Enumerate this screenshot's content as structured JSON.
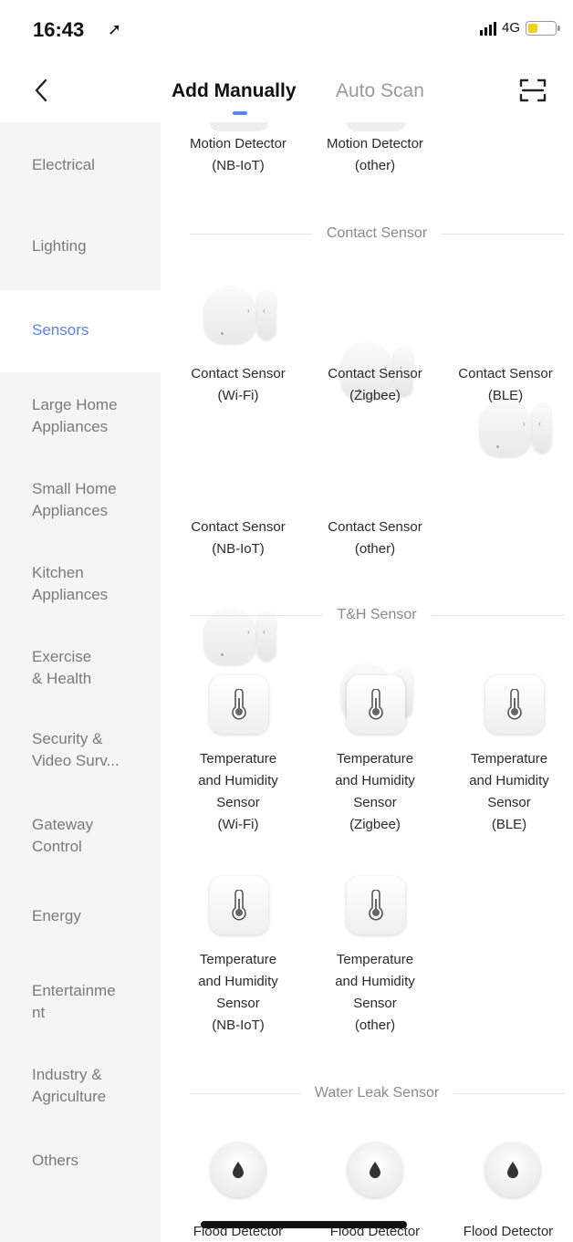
{
  "status_bar": {
    "time": "16:43",
    "network": "4G"
  },
  "nav": {
    "tabs": [
      {
        "label": "Add Manually"
      },
      {
        "label": "Auto Scan"
      }
    ]
  },
  "sidebar": {
    "items": [
      {
        "label": "Electrical"
      },
      {
        "label": "Lighting"
      },
      {
        "label": "Sensors"
      },
      {
        "label": "Large Home\nAppliances"
      },
      {
        "label": "Small Home\nAppliances"
      },
      {
        "label": "Kitchen\nAppliances"
      },
      {
        "label": "Exercise\n& Health"
      },
      {
        "label": "Security &\nVideo Surv..."
      },
      {
        "label": "Gateway\nControl"
      },
      {
        "label": "Energy"
      },
      {
        "label": "Entertainme\nnt"
      },
      {
        "label": "Industry &\nAgriculture"
      },
      {
        "label": "Others"
      }
    ],
    "active_index": 2
  },
  "content": {
    "motion": [
      {
        "line1": "Motion Detector",
        "line2": "(NB-IoT)"
      },
      {
        "line1": "Motion Detector",
        "line2": "(other)"
      }
    ],
    "contact_title": "Contact Sensor",
    "contact": [
      {
        "line1": "Contact Sensor",
        "line2": "(Wi-Fi)"
      },
      {
        "line1": "Contact Sensor",
        "line2": "(Zigbee)"
      },
      {
        "line1": "Contact Sensor",
        "line2": "(BLE)"
      },
      {
        "line1": "Contact Sensor",
        "line2": "(NB-IoT)"
      },
      {
        "line1": "Contact Sensor",
        "line2": "(other)"
      }
    ],
    "th_title": "T&H Sensor",
    "th": [
      {
        "line1": "Temperature",
        "line2": "and Humidity",
        "line3": "Sensor",
        "line4": "(Wi-Fi)"
      },
      {
        "line1": "Temperature",
        "line2": "and Humidity",
        "line3": "Sensor",
        "line4": "(Zigbee)"
      },
      {
        "line1": "Temperature",
        "line2": "and Humidity",
        "line3": "Sensor",
        "line4": "(BLE)"
      },
      {
        "line1": "Temperature",
        "line2": "and Humidity",
        "line3": "Sensor",
        "line4": "(NB-IoT)"
      },
      {
        "line1": "Temperature",
        "line2": "and Humidity",
        "line3": "Sensor",
        "line4": "(other)"
      }
    ],
    "water_title": "Water Leak Sensor",
    "flood": [
      {
        "line1": "Flood Detector"
      },
      {
        "line1": "Flood Detector"
      },
      {
        "line1": "Flood Detector"
      }
    ]
  },
  "colors": {
    "accent": "#5b83e6",
    "sidebar_bg": "#f5f5f5",
    "battery": "#f2cf1d"
  },
  "icons": {
    "back": "chevron-left-icon",
    "scan": "scan-frame-icon",
    "location": "location-arrow-icon",
    "signal": "signal-bars-icon",
    "battery": "battery-icon",
    "contact": "contact-sensor-icon",
    "th": "thermometer-icon",
    "flood": "water-drop-icon"
  }
}
